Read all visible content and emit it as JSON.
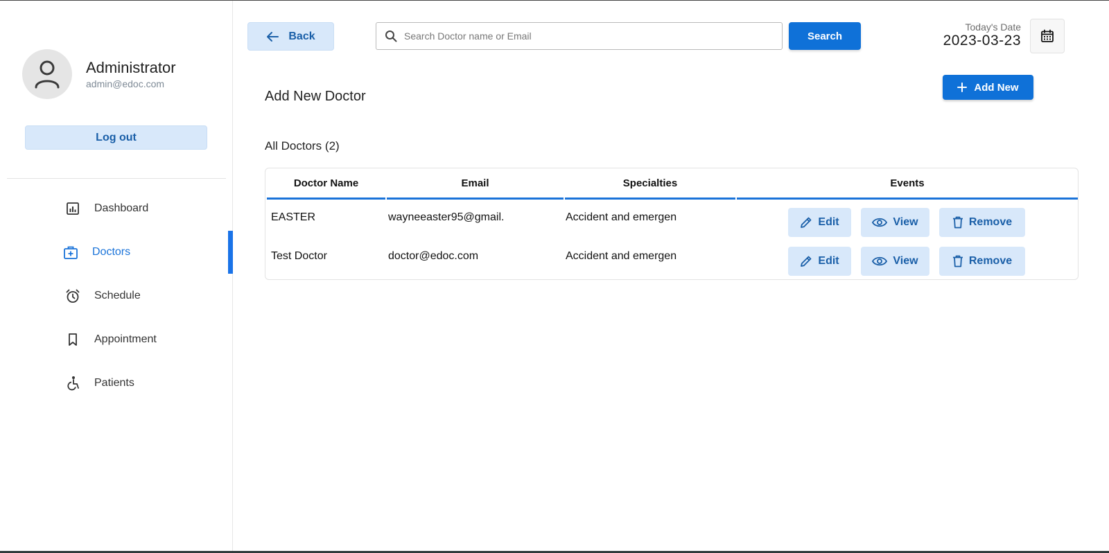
{
  "sidebar": {
    "profile": {
      "name": "Administrator",
      "email": "admin@edoc.com"
    },
    "logout_label": "Log out",
    "items": [
      {
        "label": "Dashboard",
        "icon": "dashboard-icon",
        "active": false
      },
      {
        "label": "Doctors",
        "icon": "doctor-bag-icon",
        "active": true
      },
      {
        "label": "Schedule",
        "icon": "alarm-clock-icon",
        "active": false
      },
      {
        "label": "Appointment",
        "icon": "bookmark-icon",
        "active": false
      },
      {
        "label": "Patients",
        "icon": "wheelchair-icon",
        "active": false
      }
    ]
  },
  "header": {
    "back_label": "Back",
    "search_placeholder": "Search Doctor name or Email",
    "search_value": "",
    "search_button": "Search",
    "date_label": "Today's Date",
    "date_value": "2023-03-23"
  },
  "main": {
    "add_title": "Add New Doctor",
    "add_button": "Add New",
    "list_title": "All Doctors (2)",
    "columns": [
      "Doctor Name",
      "Email",
      "Specialties",
      "Events"
    ],
    "rows": [
      {
        "name": "EASTER",
        "email": "wayneeaster95@gmail.",
        "specialty": "Accident and emergen"
      },
      {
        "name": "Test Doctor",
        "email": "doctor@edoc.com",
        "specialty": "Accident and emergen"
      }
    ],
    "actions": {
      "edit": "Edit",
      "view": "View",
      "remove": "Remove"
    }
  },
  "colors": {
    "accent": "#0f71d8",
    "light_accent": "#d8e8fa",
    "active_nav": "#1a73d9"
  }
}
